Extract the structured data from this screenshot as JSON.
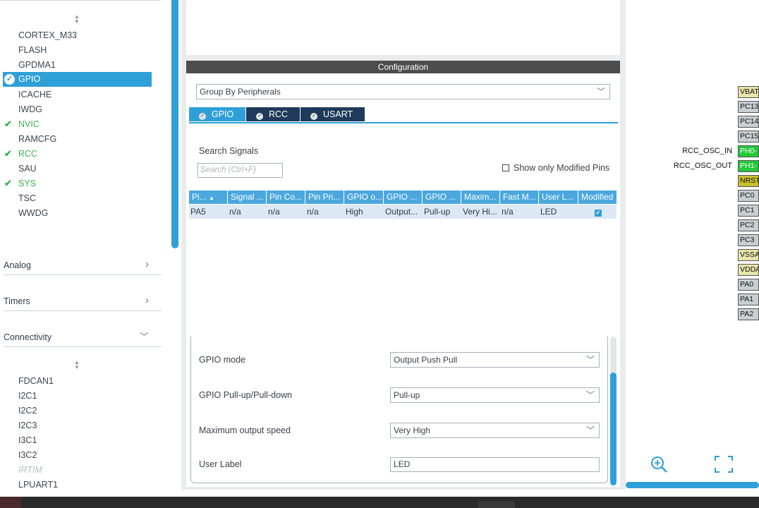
{
  "left_panel": {
    "system_core_items": [
      {
        "label": "CORTEX_M33",
        "state": "normal"
      },
      {
        "label": "FLASH",
        "state": "normal"
      },
      {
        "label": "GPDMA1",
        "state": "normal"
      },
      {
        "label": "GPIO",
        "state": "selected"
      },
      {
        "label": "ICACHE",
        "state": "normal"
      },
      {
        "label": "IWDG",
        "state": "normal"
      },
      {
        "label": "NVIC",
        "state": "configured"
      },
      {
        "label": "RAMCFG",
        "state": "normal"
      },
      {
        "label": "RCC",
        "state": "configured"
      },
      {
        "label": "SAU",
        "state": "normal"
      },
      {
        "label": "SYS",
        "state": "configured"
      },
      {
        "label": "TSC",
        "state": "normal"
      },
      {
        "label": "WWDG",
        "state": "normal"
      }
    ],
    "categories": [
      {
        "label": "Analog",
        "chevron": ">"
      },
      {
        "label": "Timers",
        "chevron": ">"
      },
      {
        "label": "Connectivity",
        "chevron": "v"
      }
    ],
    "connectivity_items": [
      {
        "label": "FDCAN1",
        "state": "normal"
      },
      {
        "label": "I2C1",
        "state": "normal"
      },
      {
        "label": "I2C2",
        "state": "normal"
      },
      {
        "label": "I2C3",
        "state": "normal"
      },
      {
        "label": "I3C1",
        "state": "normal"
      },
      {
        "label": "I3C2",
        "state": "normal"
      },
      {
        "label": "IRTIM",
        "state": "disabled"
      },
      {
        "label": "LPUART1",
        "state": "normal"
      }
    ]
  },
  "config": {
    "header": "Configuration",
    "group_by": "Group By Peripherals",
    "tabs": [
      {
        "label": "GPIO",
        "active": true
      },
      {
        "label": "RCC",
        "active": false
      },
      {
        "label": "USART",
        "active": false
      }
    ],
    "search_label": "Search Signals",
    "search_placeholder": "Search (Ctrl+F)",
    "show_modified_label": "Show only Modified Pins",
    "table": {
      "columns": [
        "Pi...",
        "Signal ...",
        "Pin Co...",
        "Pin Pri...",
        "GPIO o...",
        "GPIO ...",
        "GPIO ...",
        "Maxim...",
        "Fast M...",
        "User L...",
        "Modified"
      ],
      "rows": [
        [
          "PA5",
          "n/a",
          "n/a",
          "n/a",
          "High",
          "Output...",
          "Pull-up",
          "Very Hi...",
          "n/a",
          "LED",
          ""
        ]
      ]
    },
    "details": [
      {
        "label": "GPIO mode",
        "value": "Output Push Pull",
        "type": "select"
      },
      {
        "label": "GPIO Pull-up/Pull-down",
        "value": "Pull-up",
        "type": "select"
      },
      {
        "label": "Maximum output speed",
        "value": "Very High",
        "type": "select"
      },
      {
        "label": "User Label",
        "value": "LED",
        "type": "text"
      }
    ]
  },
  "pinout": {
    "signal_labels": {
      "ph0": "RCC_OSC_IN",
      "ph1": "RCC_OSC_OUT"
    },
    "pins": [
      {
        "label": "VBAT",
        "color": "khaki"
      },
      {
        "label": "PC13",
        "color": "gray"
      },
      {
        "label": "PC14",
        "color": "gray"
      },
      {
        "label": "PC15",
        "color": "gray"
      },
      {
        "label": "PH0-",
        "color": "green"
      },
      {
        "label": "PH1-",
        "color": "green"
      },
      {
        "label": "NRST",
        "color": "olive"
      },
      {
        "label": "PC0",
        "color": "gray"
      },
      {
        "label": "PC1",
        "color": "gray"
      },
      {
        "label": "PC2",
        "color": "gray"
      },
      {
        "label": "PC3",
        "color": "gray"
      },
      {
        "label": "VSSA",
        "color": "khaki"
      },
      {
        "label": "VDDA",
        "color": "khaki"
      },
      {
        "label": "PA0",
        "color": "gray"
      },
      {
        "label": "PA1",
        "color": "gray"
      },
      {
        "label": "PA2",
        "color": "gray"
      }
    ]
  },
  "colors": {
    "accent": "#2f9fd8",
    "configured_green": "#3cb44b",
    "pin_green": "#22c93a"
  }
}
